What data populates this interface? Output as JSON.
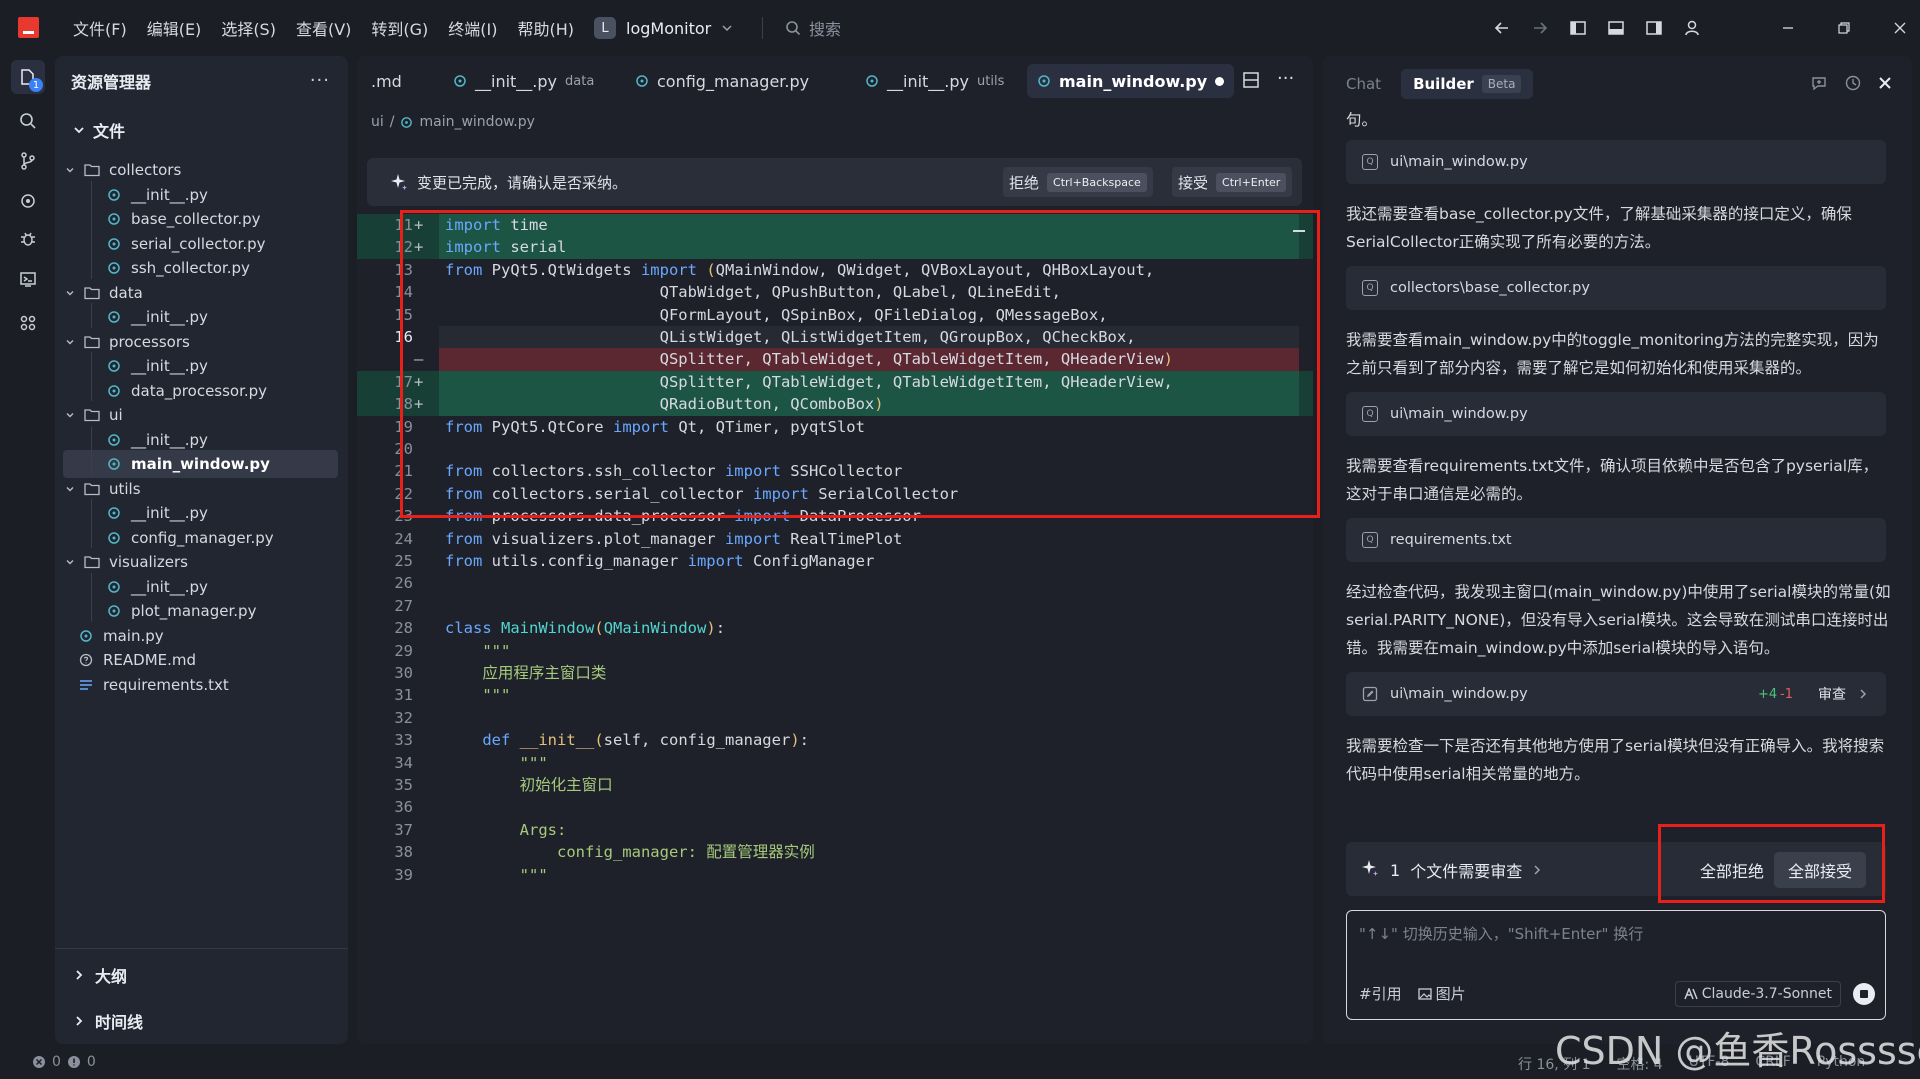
{
  "menus": [
    "文件(F)",
    "编辑(E)",
    "选择(S)",
    "查看(V)",
    "转到(G)",
    "终端(I)",
    "帮助(H)"
  ],
  "project": {
    "badge": "L",
    "name": "logMonitor"
  },
  "search": {
    "placeholder": "搜索"
  },
  "explorer": {
    "title": "资源管理器",
    "section": "文件",
    "tree": [
      {
        "label": "collectors",
        "type": "folder"
      },
      {
        "label": "__init__.py",
        "type": "py"
      },
      {
        "label": "base_collector.py",
        "type": "py"
      },
      {
        "label": "serial_collector.py",
        "type": "py"
      },
      {
        "label": "ssh_collector.py",
        "type": "py"
      },
      {
        "label": "data",
        "type": "folder"
      },
      {
        "label": "__init__.py",
        "type": "py"
      },
      {
        "label": "processors",
        "type": "folder"
      },
      {
        "label": "__init__.py",
        "type": "py"
      },
      {
        "label": "data_processor.py",
        "type": "py"
      },
      {
        "label": "ui",
        "type": "folder"
      },
      {
        "label": "__init__.py",
        "type": "py"
      },
      {
        "label": "main_window.py",
        "type": "py"
      },
      {
        "label": "utils",
        "type": "folder"
      },
      {
        "label": "__init__.py",
        "type": "py"
      },
      {
        "label": "config_manager.py",
        "type": "py"
      },
      {
        "label": "visualizers",
        "type": "folder"
      },
      {
        "label": "__init__.py",
        "type": "py"
      },
      {
        "label": "plot_manager.py",
        "type": "py"
      },
      {
        "label": "main.py",
        "type": "py"
      },
      {
        "label": "README.md",
        "type": "md"
      },
      {
        "label": "requirements.txt",
        "type": "txt"
      }
    ],
    "selected_index": 12,
    "outline": "大纲",
    "timeline": "时间线"
  },
  "tabs": [
    {
      "label": ".md",
      "sub": ""
    },
    {
      "label": "__init__.py",
      "sub": "data"
    },
    {
      "label": "config_manager.py",
      "sub": ""
    },
    {
      "label": "__init__.py",
      "sub": "utils"
    },
    {
      "label": "main_window.py",
      "sub": ""
    }
  ],
  "breadcrumb": {
    "folder": "ui",
    "file": "main_window.py"
  },
  "notice": {
    "text": "变更已完成，请确认是否采纳。",
    "reject": "拒绝",
    "reject_key": "Ctrl+Backspace",
    "accept": "接受",
    "accept_key": "Ctrl+Enter"
  },
  "code_lines": [
    {
      "n": "11",
      "mark": "+",
      "kind": "add",
      "html": "<span class='kw'>import</span> time"
    },
    {
      "n": "12",
      "mark": "+",
      "kind": "add",
      "html": "<span class='kw'>import</span> serial"
    },
    {
      "n": "13",
      "mark": "",
      "kind": "",
      "html": "<span class='kw'>from</span> PyQt5.QtWidgets <span class='kw'>import</span> <span class='paren'>(</span>QMainWindow, QWidget, QVBoxLayout, QHBoxLayout,"
    },
    {
      "n": "14",
      "mark": "",
      "kind": "",
      "html": "                       QTabWidget, QPushButton, QLabel, QLineEdit,"
    },
    {
      "n": "15",
      "mark": "",
      "kind": "",
      "html": "                       QFormLayout, QSpinBox, QFileDialog, QMessageBox,"
    },
    {
      "n": "16",
      "mark": "",
      "kind": "curl",
      "html": "                       QListWidget, QListWidgetItem, QGroupBox, QCheckBox,"
    },
    {
      "n": "",
      "mark": "—",
      "kind": "del",
      "html": "                       QSplitter, QTableWidget, QTableWidgetItem, QHeaderView<span class='paren'>)</span>"
    },
    {
      "n": "17",
      "mark": "+",
      "kind": "add",
      "html": "                       QSplitter, QTableWidget, QTableWidgetItem, QHeaderView,"
    },
    {
      "n": "18",
      "mark": "+",
      "kind": "add",
      "html": "                       QRadioButton, QComboBox<span class='paren'>)</span>"
    },
    {
      "n": "19",
      "mark": "",
      "kind": "",
      "html": "<span class='kw'>from</span> PyQt5.QtCore <span class='kw'>import</span> Qt, QTimer, pyqtSlot"
    },
    {
      "n": "20",
      "mark": "",
      "kind": "",
      "html": ""
    },
    {
      "n": "21",
      "mark": "",
      "kind": "",
      "html": "<span class='kw'>from</span> collectors.ssh_collector <span class='kw'>import</span> SSHCollector"
    },
    {
      "n": "22",
      "mark": "",
      "kind": "",
      "html": "<span class='kw'>from</span> collectors.serial_collector <span class='kw'>import</span> SerialCollector"
    },
    {
      "n": "23",
      "mark": "",
      "kind": "",
      "html": "<span class='kw'>from</span> processors.data_processor <span class='kw'>import</span> DataProcessor"
    },
    {
      "n": "24",
      "mark": "",
      "kind": "",
      "html": "<span class='kw'>from</span> visualizers.plot_manager <span class='kw'>import</span> RealTimePlot"
    },
    {
      "n": "25",
      "mark": "",
      "kind": "",
      "html": "<span class='kw'>from</span> utils.config_manager <span class='kw'>import</span> ConfigManager"
    },
    {
      "n": "26",
      "mark": "",
      "kind": "",
      "html": ""
    },
    {
      "n": "27",
      "mark": "",
      "kind": "",
      "html": ""
    },
    {
      "n": "28",
      "mark": "",
      "kind": "",
      "html": "<span class='kw'>class</span> <span class='cls'>MainWindow</span><span class='paren'>(</span><span class='cls'>QMainWindow</span><span class='paren'>)</span>:"
    },
    {
      "n": "29",
      "mark": "",
      "kind": "",
      "html": "    <span class='str'>\"\"\"</span>"
    },
    {
      "n": "30",
      "mark": "",
      "kind": "",
      "html": "    <span class='str'>应用程序主窗口类</span>"
    },
    {
      "n": "31",
      "mark": "",
      "kind": "",
      "html": "    <span class='str'>\"\"\"</span>"
    },
    {
      "n": "32",
      "mark": "",
      "kind": "",
      "html": ""
    },
    {
      "n": "33",
      "mark": "",
      "kind": "",
      "html": "    <span class='kw'>def</span> <span class='fn'>__init__</span><span class='paren'>(</span>self, config_manager<span class='paren'>)</span>:"
    },
    {
      "n": "34",
      "mark": "",
      "kind": "",
      "html": "        <span class='str'>\"\"\"</span>"
    },
    {
      "n": "35",
      "mark": "",
      "kind": "",
      "html": "        <span class='str'>初始化主窗口</span>"
    },
    {
      "n": "36",
      "mark": "",
      "kind": "",
      "html": ""
    },
    {
      "n": "37",
      "mark": "",
      "kind": "",
      "html": "        <span class='str'>Args:</span>"
    },
    {
      "n": "38",
      "mark": "",
      "kind": "",
      "html": "            <span class='str'>config_manager: 配置管理器实例</span>"
    },
    {
      "n": "39",
      "mark": "",
      "kind": "",
      "html": "        <span class='str'>\"\"\"</span>"
    }
  ],
  "chat": {
    "tab_chat": "Chat",
    "tab_builder": "Builder",
    "beta": "Beta",
    "top_fragment": "句。",
    "chips": [
      "ui\\main_window.py",
      "collectors\\base_collector.py",
      "ui\\main_window.py",
      "requirements.txt"
    ],
    "paragraphs": [
      "我还需要查看base_collector.py文件，了解基础采集器的接口定义，确保SerialCollector正确实现了所有必要的方法。",
      "我需要查看main_window.py中的toggle_monitoring方法的完整实现，因为之前只看到了部分内容，需要了解它是如何初始化和使用采集器的。",
      "我需要查看requirements.txt文件，确认项目依赖中是否包含了pyserial库，这对于串口通信是必需的。",
      "经过检查代码，我发现主窗口(main_window.py)中使用了serial模块的常量(如serial.PARITY_NONE)，但没有导入serial模块。这会导致在测试串口连接时出错。我需要在main_window.py中添加serial模块的导入语句。",
      "我需要检查一下是否还有其他地方使用了serial模块但没有正确导入。我将搜索代码中使用serial相关常量的地方。"
    ],
    "edit_chip": {
      "file": "ui\\main_window.py",
      "added": "+4",
      "removed": "-1",
      "review": "审查"
    },
    "review_bar": {
      "count": "1",
      "text": "个文件需要审查",
      "reject_all": "全部拒绝",
      "accept_all": "全部接受"
    },
    "input_placeholder": "\"↑↓\" 切换历史输入，\"Shift+Enter\" 换行",
    "tool_ref": "#引用",
    "tool_img": "图片",
    "model": "Claude-3.7-Sonnet"
  },
  "status": {
    "errors": "0",
    "warnings": "0",
    "position": "行 16, 列 1",
    "spaces": "空格: 4",
    "encoding": "UTF-8",
    "eol": "CRLF",
    "language": "Python"
  },
  "watermark": "CSDN @鱼香Rosssse"
}
